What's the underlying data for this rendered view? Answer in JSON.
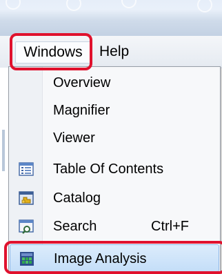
{
  "menubar": {
    "items": [
      {
        "label": "Windows"
      },
      {
        "label": "Help"
      }
    ]
  },
  "dropdown": {
    "items": [
      {
        "label": "Overview",
        "icon": null
      },
      {
        "label": "Magnifier",
        "icon": null
      },
      {
        "label": "Viewer",
        "icon": null
      },
      {
        "label": "Table Of Contents",
        "icon": "table-of-contents-icon"
      },
      {
        "label": "Catalog",
        "icon": "catalog-icon"
      },
      {
        "label": "Search",
        "shortcut": "Ctrl+F",
        "icon": "search-window-icon"
      },
      {
        "label": "Image Analysis",
        "icon": "image-analysis-icon",
        "selected": true
      }
    ]
  },
  "colors": {
    "highlight": "#e0112d",
    "selected_bg": "#c4def8"
  }
}
